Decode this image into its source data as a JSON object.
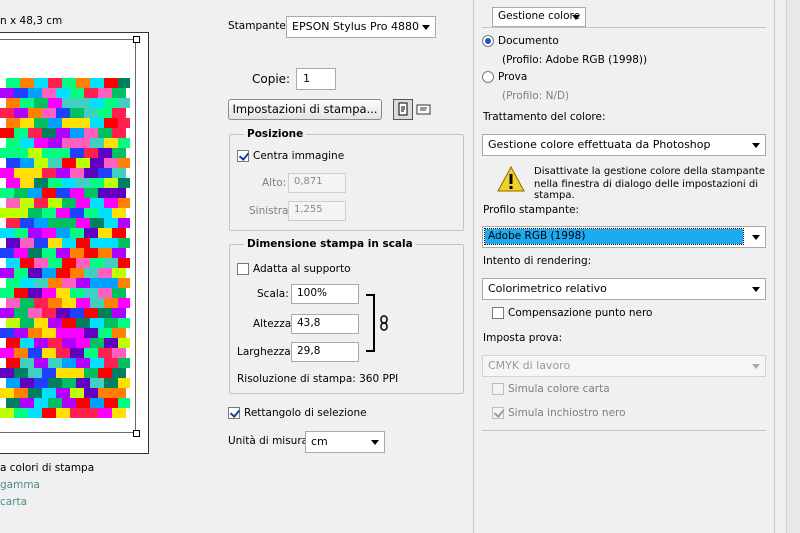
{
  "preview": {
    "size_text": "n x 48,3 cm",
    "legend_items": [
      "a colori di stampa",
      "gamma",
      "carta"
    ]
  },
  "printer": {
    "label": "Stampante:",
    "value": "EPSON Stylus Pro 4880",
    "copies_label": "Copie:",
    "copies_value": "1",
    "settings_button": "Impostazioni di stampa..."
  },
  "position": {
    "title": "Posizione",
    "center_label": "Centra immagine",
    "center_checked": true,
    "top_label": "Alto:",
    "top_value": "0,871",
    "left_label": "Sinistra:",
    "left_value": "1,255"
  },
  "scaled": {
    "title": "Dimensione stampa in scala",
    "fit_label": "Adatta al supporto",
    "fit_checked": false,
    "scale_label": "Scala:",
    "scale_value": "100%",
    "height_label": "Altezza:",
    "height_value": "43,8",
    "width_label": "Larghezza:",
    "width_value": "29,8",
    "resolution": "Risoluzione di stampa: 360 PPI"
  },
  "bounding": {
    "label": "Rettangolo di selezione",
    "checked": true
  },
  "units": {
    "label": "Unità di misura:",
    "value": "cm"
  },
  "color": {
    "section_dropdown": "Gestione colore",
    "document_label": "Documento",
    "document_profile": "(Profilo: Adobe RGB (1998))",
    "proof_label": "Prova",
    "proof_profile": "(Profilo: N/D)",
    "handling_label": "Trattamento del colore:",
    "handling_value": "Gestione colore effettuata da Photoshop",
    "warning_line1": "Disattivate la gestione colore della stampante",
    "warning_line2": "nella finestra di dialogo delle impostazioni di stampa.",
    "printer_profile_label": "Profilo stampante:",
    "printer_profile_value": "Adobe RGB (1998)",
    "intent_label": "Intento di rendering:",
    "intent_value": "Colorimetrico relativo",
    "bpc_label": "Compensazione punto nero",
    "bpc_checked": false,
    "proof_setup_label": "Imposta prova:",
    "proof_setup_value": "CMYK di lavoro",
    "sim_paper_label": "Simula colore carta",
    "sim_ink_label": "Simula inchiostro nero",
    "sim_ink_checked": true
  }
}
